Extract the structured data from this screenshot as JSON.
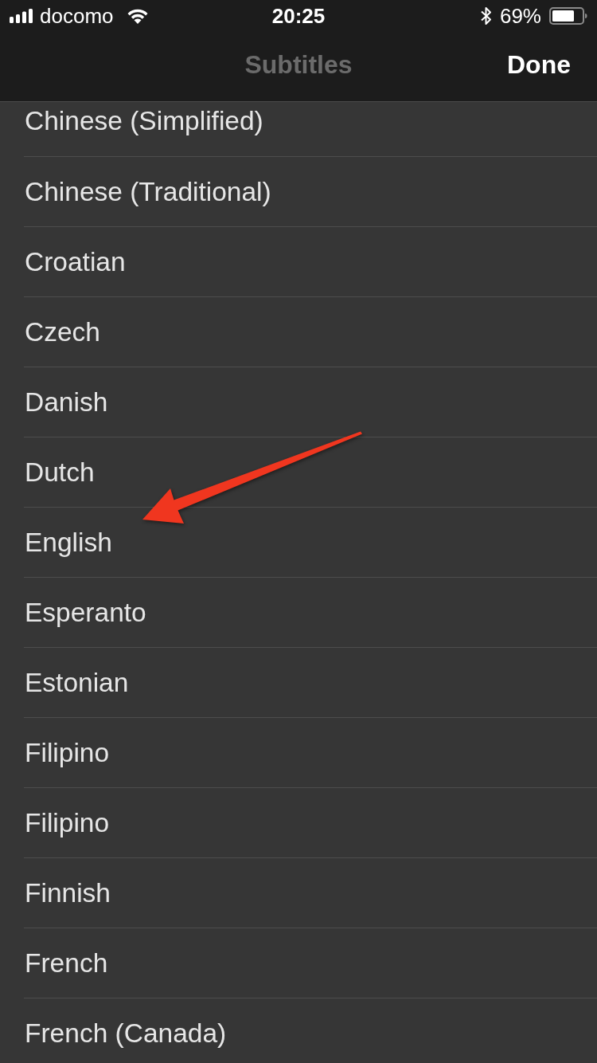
{
  "status_bar": {
    "carrier": "docomo",
    "time": "20:25",
    "battery": "69%"
  },
  "nav_bar": {
    "title": "Subtitles",
    "done_button": "Done"
  },
  "languages": [
    "Chinese (Simplified)",
    "Chinese (Traditional)",
    "Croatian",
    "Czech",
    "Danish",
    "Dutch",
    "English",
    "Esperanto",
    "Estonian",
    "Filipino",
    "Filipino",
    "Finnish",
    "French",
    "French (Canada)"
  ]
}
